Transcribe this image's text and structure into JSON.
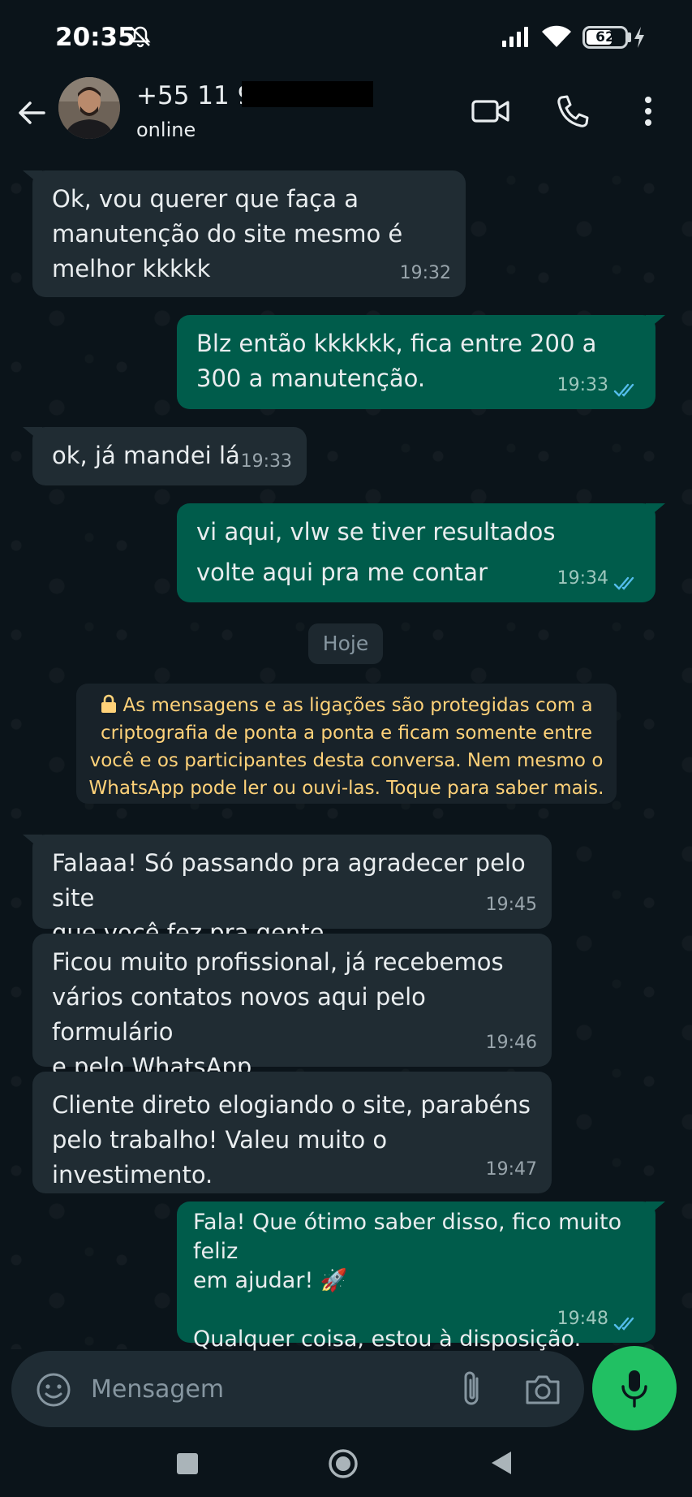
{
  "status_bar": {
    "time": "20:35",
    "battery": "62",
    "battery_fraction": 0.62,
    "icons": [
      "bell-off-icon",
      "signal-icon",
      "wifi-icon",
      "battery-icon",
      "charging-icon"
    ]
  },
  "header": {
    "contact_name": "+55 11 9",
    "status": "online",
    "icons": [
      "back-arrow-icon",
      "video-call-icon",
      "voice-call-icon",
      "more-vertical-icon"
    ]
  },
  "messages": [
    {
      "direction": "in",
      "text": "Ok, vou querer que faça a\nmanutenção do site mesmo é\nmelhor kkkkk",
      "time": "19:32"
    },
    {
      "direction": "out",
      "text": "Blz então kkkkkk, fica entre 200 a\n300 a manutenção.",
      "time": "19:33",
      "status": "read"
    },
    {
      "direction": "in",
      "text": "ok, já mandei lá",
      "time": "19:33"
    },
    {
      "direction": "out",
      "text": "vi aqui, vlw se tiver resultados\nvolte aqui pra me contar",
      "time": "19:34",
      "status": "read"
    },
    {
      "direction": "in",
      "text": "Falaaa! Só passando pra agradecer pelo site\nque você fez pra gente.",
      "time": "19:45"
    },
    {
      "direction": "in",
      "text": "Ficou muito profissional, já recebemos\nvários contatos novos aqui pelo formulário\ne pelo WhatsApp.",
      "time": "19:46"
    },
    {
      "direction": "in",
      "text": "Cliente direto elogiando o site, parabéns\npelo trabalho! Valeu muito o investimento.",
      "time": "19:47"
    },
    {
      "direction": "out",
      "text": "Fala! Que ótimo saber disso, fico muito feliz\nem ajudar! 🚀\n\nQualquer coisa, estou à disposição.",
      "time": "19:48",
      "status": "read"
    }
  ],
  "date_divider": "Hoje",
  "encryption_notice": {
    "lines": [
      "As mensagens e as ligações são protegidas com a",
      "criptografia de ponta a ponta e ficam somente entre",
      "você e os participantes desta conversa. Nem mesmo o",
      "WhatsApp pode ler ou ouvi-las. Toque para saber mais."
    ],
    "color": "#ffd279"
  },
  "composer": {
    "placeholder": "Mensagem",
    "value": "",
    "icons": [
      "emoji-icon",
      "attach-icon",
      "camera-icon",
      "mic-icon"
    ],
    "mic_color": "#21c063"
  },
  "colors": {
    "background": "#0b141a",
    "incoming_bubble": "#202c33",
    "outgoing_bubble": "#005c4b",
    "read_ticks": "#53bdeb"
  }
}
